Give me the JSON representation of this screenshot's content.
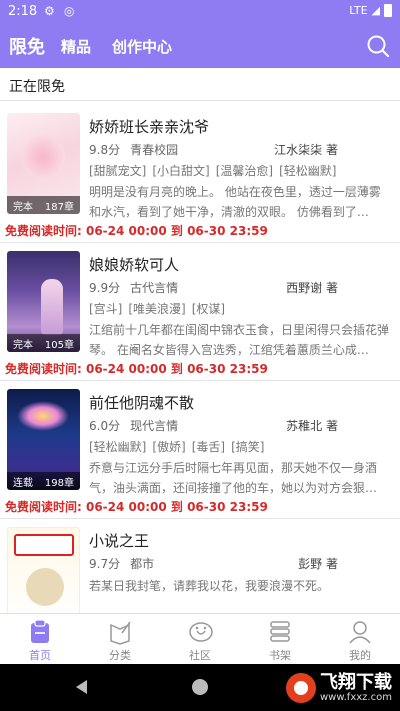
{
  "status": {
    "time": "2:18",
    "network": "LTE"
  },
  "header": {
    "tabs": [
      {
        "label": "限免"
      },
      {
        "label": "精品"
      },
      {
        "label": "创作中心"
      }
    ]
  },
  "section": {
    "title": "正在限免"
  },
  "books": [
    {
      "title": "娇娇班长亲亲沈爷",
      "score": "9.8分",
      "genre": "青春校园",
      "author": "江水柒柒 著",
      "tags": [
        "[甜腻宠文]",
        "[小白甜文]",
        "[温馨治愈]",
        "[轻松幽默]"
      ],
      "desc": "明明是没有月亮的晚上。 他站在夜色里，透过一层薄雾和水汽，看到了她干净，清澈的双眼。 仿佛看到了…",
      "status": "完本",
      "chapters": "187章",
      "free": "免费阅读时间: 06-24 00:00 到 06-30 23:59"
    },
    {
      "title": "娘娘娇软可人",
      "score": "9.9分",
      "genre": "古代言情",
      "author": "西野谢 著",
      "tags": [
        "[宫斗]",
        "[唯美浪漫]",
        "[权谋]"
      ],
      "desc": "江绾前十几年都在闺阁中锦衣玉食，日里闲得只会插花弹琴。 在阉名女皆得入宫选秀，江绾凭着蕙质兰心成…",
      "status": "完本",
      "chapters": "105章",
      "free": "免费阅读时间: 06-24 00:00 到 06-30 23:59"
    },
    {
      "title": "前任他阴魂不散",
      "score": "6.0分",
      "genre": "现代言情",
      "author": "苏稚北 著",
      "tags": [
        "[轻松幽默]",
        "[傲娇]",
        "[毒舌]",
        "[搞笑]"
      ],
      "desc": "乔意与江远分手后时隔七年再见面，那天她不仅一身酒气，油头满面，还间接撞了他的车，她以为对方会狠…",
      "status": "连载",
      "chapters": "198章",
      "free": "免费阅读时间: 06-24 00:00 到 06-30 23:59"
    },
    {
      "title": "小说之王",
      "score": "9.7分",
      "genre": "都市",
      "author": "彭野 著",
      "tags": [],
      "desc": "若某日我封笔，请葬我以花，我要浪漫不死。",
      "status": "",
      "chapters": "",
      "free": ""
    }
  ],
  "nav": [
    {
      "label": "首页",
      "icon": "book-icon"
    },
    {
      "label": "分类",
      "icon": "category-icon"
    },
    {
      "label": "社区",
      "icon": "community-icon"
    },
    {
      "label": "书架",
      "icon": "bookshelf-icon"
    },
    {
      "label": "我的",
      "icon": "profile-icon"
    }
  ],
  "watermark": {
    "brand": "飞翔下载",
    "url": "www.fxxz.com"
  },
  "colors": {
    "accent": "#8f7cf3",
    "free_red": "#d52a2a"
  }
}
